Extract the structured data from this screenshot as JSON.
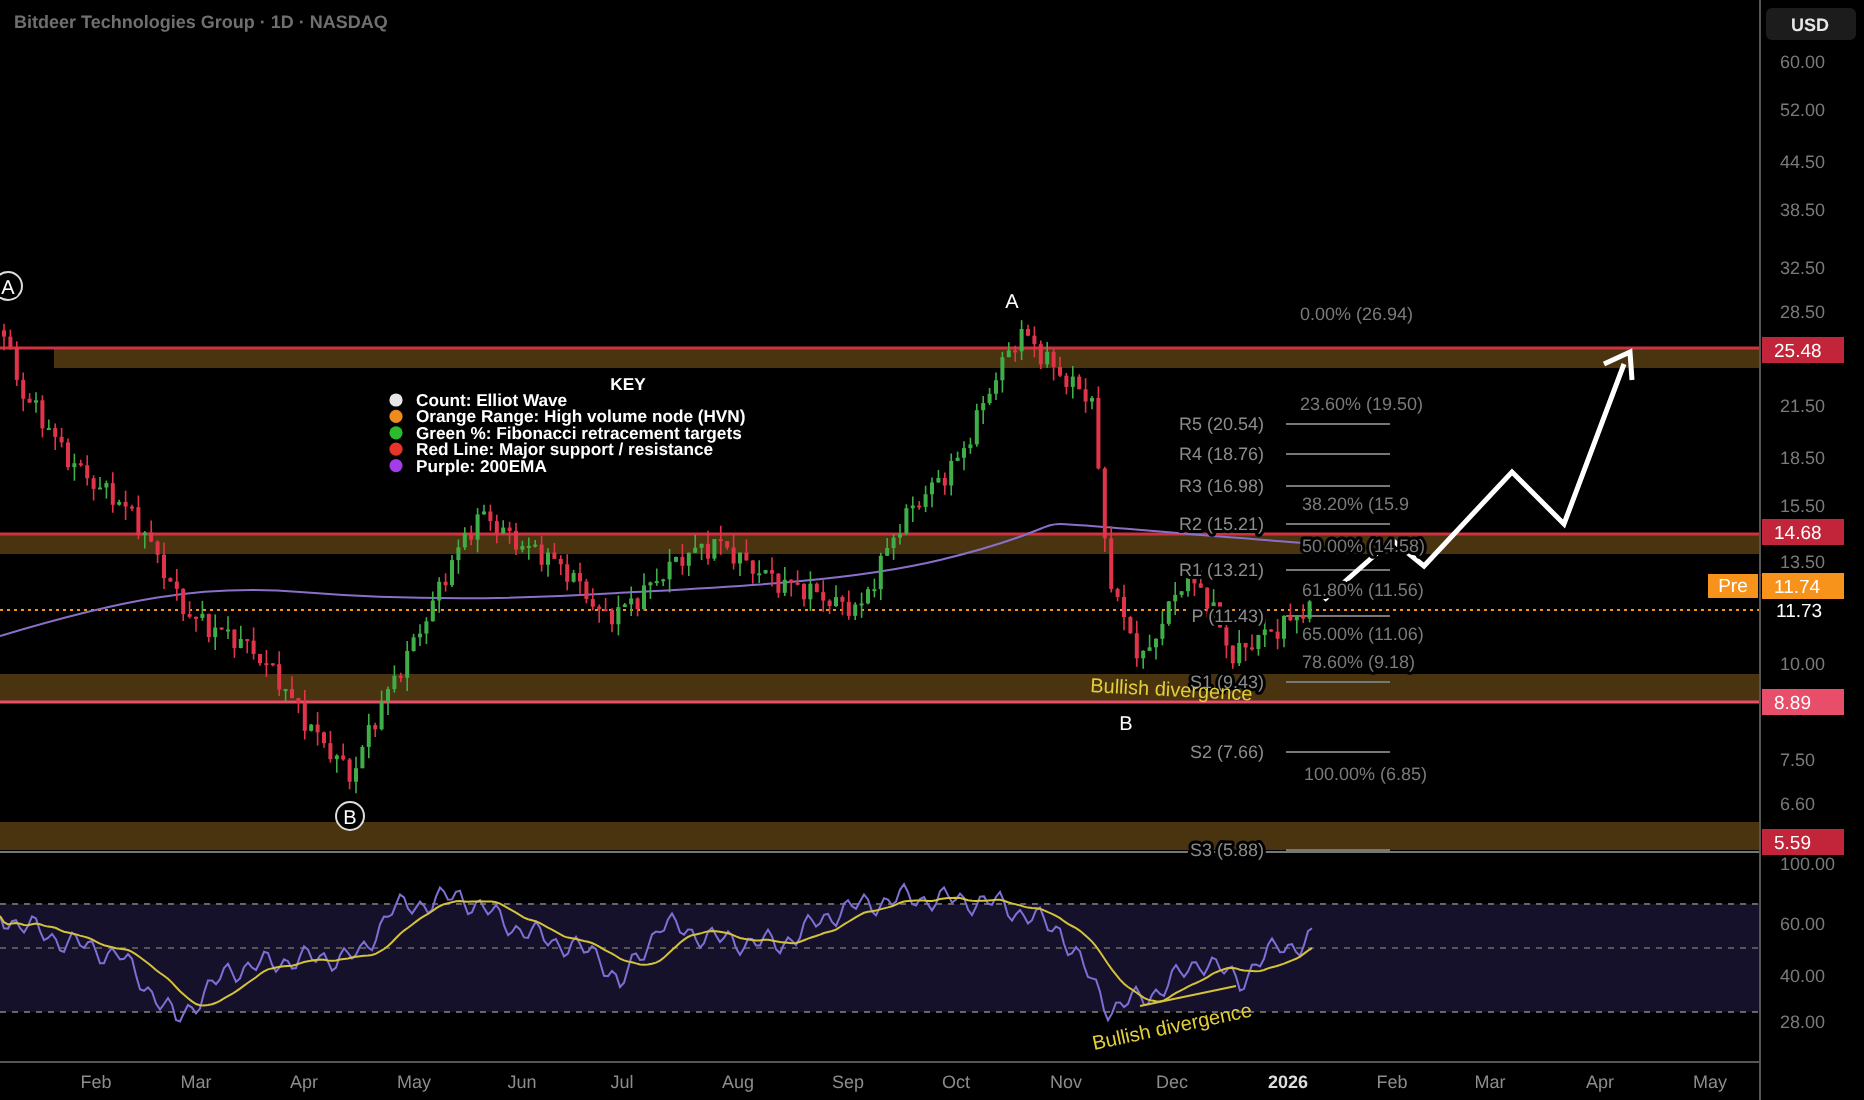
{
  "header": {
    "title": "Bitdeer Technologies Group · 1D · NASDAQ"
  },
  "currency_button": "USD",
  "price_axis": {
    "ticks": [
      "60.00",
      "52.00",
      "44.50",
      "38.50",
      "32.50",
      "28.50",
      "21.50",
      "18.50",
      "15.50",
      "13.50",
      "10.00",
      "7.50",
      "6.60"
    ],
    "tags": [
      {
        "label": "25.48",
        "kind": "tag",
        "color": "#c2253a"
      },
      {
        "label": "14.68",
        "kind": "tag",
        "color": "#c2253a"
      },
      {
        "label": "11.74",
        "kind": "tag",
        "color": "#f7931a",
        "prefix": "Pre"
      },
      {
        "label": "11.73",
        "kind": "plain",
        "color": "#ffffff"
      },
      {
        "label": "8.89",
        "kind": "tag",
        "color": "#e84d6a"
      },
      {
        "label": "5.59",
        "kind": "tag",
        "color": "#c2253a"
      }
    ]
  },
  "key": {
    "title": "KEY",
    "items": [
      {
        "label": "Count: Elliot Wave",
        "color": "#e6e6e6"
      },
      {
        "label": "Orange Range: High volume node (HVN)",
        "color": "#f08a1c"
      },
      {
        "label": "Green %: Fibonacci retracement targets",
        "color": "#2dbb2d"
      },
      {
        "label": "Red Line: Major support / resistance",
        "color": "#e8352a"
      },
      {
        "label": "Purple: 200EMA",
        "color": "#a43be8"
      }
    ]
  },
  "wave_labels": [
    {
      "label": "A",
      "circled": true
    },
    {
      "label": "A",
      "circled": false
    },
    {
      "label": "B",
      "circled": false
    },
    {
      "label": "B",
      "circled": true
    }
  ],
  "fib_levels": [
    "0.00% (26.94)",
    "23.60% (19.50)",
    "38.20% (15.9",
    "50.00% (14.58)",
    "61.80% (11.56)",
    "65.00% (11.06)",
    "78.60% (9.18)",
    "100.00% (6.85)"
  ],
  "pivot_levels": [
    "R5 (20.54)",
    "R4 (18.76)",
    "R3 (16.98)",
    "R2 (15.21)",
    "R1 (13.21)",
    "P (11.43)",
    "S1 (9.43)",
    "S2 (7.66)",
    "S3 (5.88)"
  ],
  "price_divergence_label": "Bullish divergence",
  "rsi": {
    "axis": [
      "100.00",
      "60.00",
      "40.00",
      "28.00"
    ],
    "divergence_label": "Bullish divergence"
  },
  "time_axis": [
    {
      "label": "Feb",
      "bold": false
    },
    {
      "label": "Mar",
      "bold": false
    },
    {
      "label": "Apr",
      "bold": false
    },
    {
      "label": "May",
      "bold": false
    },
    {
      "label": "Jun",
      "bold": false
    },
    {
      "label": "Jul",
      "bold": false
    },
    {
      "label": "Aug",
      "bold": false
    },
    {
      "label": "Sep",
      "bold": false
    },
    {
      "label": "Oct",
      "bold": false
    },
    {
      "label": "Nov",
      "bold": false
    },
    {
      "label": "Dec",
      "bold": false
    },
    {
      "label": "2026",
      "bold": true
    },
    {
      "label": "Feb",
      "bold": false
    },
    {
      "label": "Mar",
      "bold": false
    },
    {
      "label": "Apr",
      "bold": false
    },
    {
      "label": "May",
      "bold": false
    }
  ]
}
